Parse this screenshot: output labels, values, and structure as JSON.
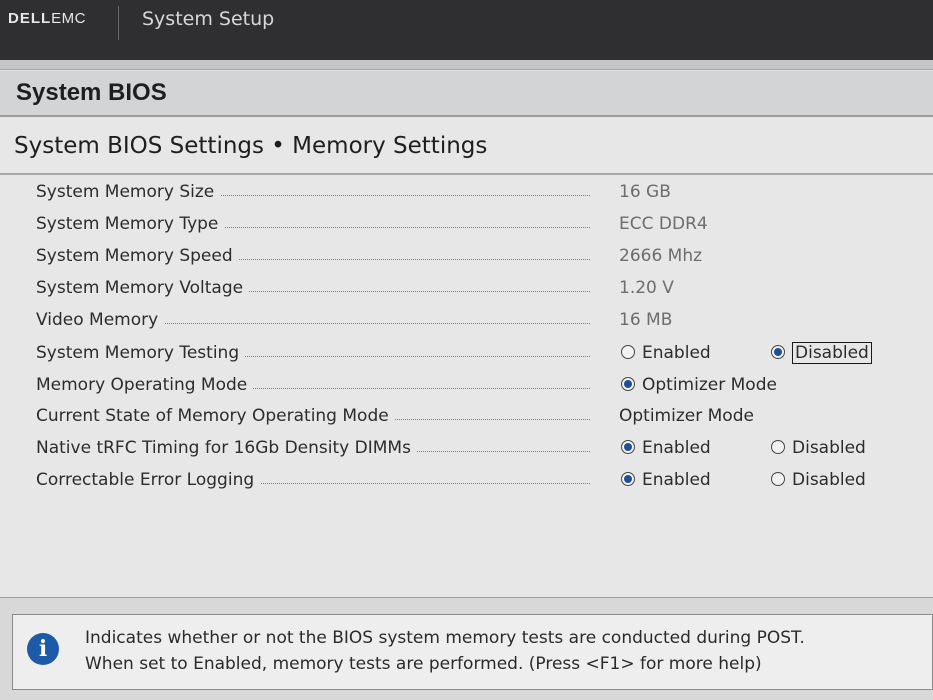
{
  "header": {
    "brand_bold": "DELL",
    "brand_light": "EMC",
    "app_title": "System Setup"
  },
  "bios_title": "System BIOS",
  "page_title": "System BIOS Settings • Memory Settings",
  "settings": [
    {
      "label": "System Memory Size",
      "value": "16 GB"
    },
    {
      "label": "System Memory Type",
      "value": "ECC DDR4"
    },
    {
      "label": "System Memory Speed",
      "value": "2666 Mhz"
    },
    {
      "label": "System Memory Voltage",
      "value": "1.20 V"
    },
    {
      "label": "Video Memory",
      "value": "16 MB"
    },
    {
      "label": "System Memory Testing",
      "options": [
        "Enabled",
        "Disabled"
      ],
      "selected": "Disabled"
    },
    {
      "label": "Memory Operating Mode",
      "options": [
        "Optimizer Mode"
      ],
      "selected": "Optimizer Mode"
    },
    {
      "label": "Current State of Memory Operating Mode",
      "value": "Optimizer Mode"
    },
    {
      "label": "Native tRFC Timing for 16Gb Density DIMMs",
      "options": [
        "Enabled",
        "Disabled"
      ],
      "selected": "Enabled"
    },
    {
      "label": "Correctable Error Logging",
      "options": [
        "Enabled",
        "Disabled"
      ],
      "selected": "Enabled"
    }
  ],
  "help": {
    "icon": "info-icon",
    "line1": "Indicates whether or not the BIOS system memory tests are conducted during POST.",
    "line2": "When set to Enabled, memory tests are performed. (Press <F1> for more help)"
  },
  "colors": {
    "topbar": "#2f2f31",
    "radio_selected": "#1f4f9a",
    "info_icon": "#1d5aa8"
  }
}
